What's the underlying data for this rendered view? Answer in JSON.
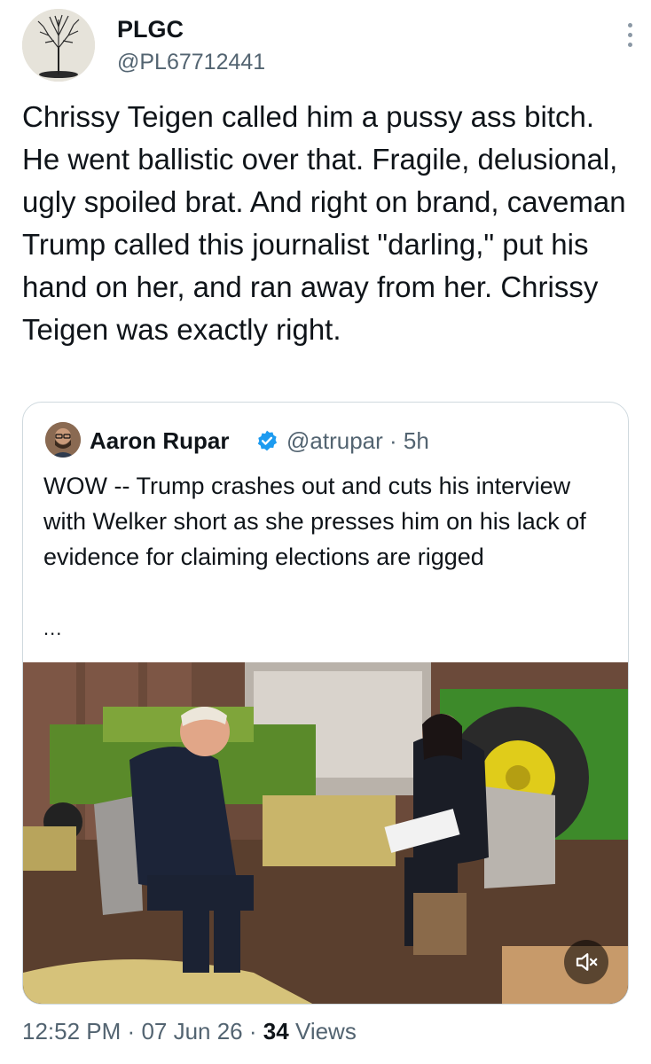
{
  "author": {
    "name": "PLGC",
    "handle": "@PL67712441",
    "avatar_icon": "bare-tree-avatar"
  },
  "tweet": {
    "text": "Chrissy Teigen called him a pussy ass bitch. He went ballistic over that. Fragile, delusional, ugly spoiled brat. And right on brand, caveman Trump called this journalist \"darling,\" put his hand on her, and ran away from her. Chrissy Teigen was exactly right."
  },
  "quoted_tweet": {
    "author_name": "Aaron Rupar",
    "verified_icon": "verified-badge-icon",
    "handle_time": "@atrupar · 5h",
    "text": "WOW -- Trump crashes out and cuts his interview with Welker short as she presses him on his lack of evidence for claiming elections are rigged",
    "ellipsis": "...",
    "media_description_icon": "video-thumbnail",
    "mute_icon": "speaker-muted-icon"
  },
  "meta": {
    "time": "12:52 PM",
    "separator": "·",
    "date": "07 Jun 26",
    "views_count": "34",
    "views_label": "Views"
  },
  "colors": {
    "text_primary": "#0f1419",
    "text_secondary": "#536471",
    "border": "#cfd9de",
    "verified": "#1d9bf0"
  }
}
